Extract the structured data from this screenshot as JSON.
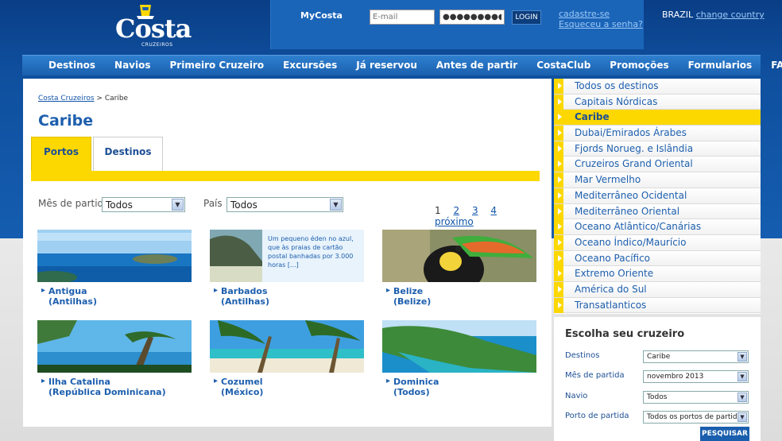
{
  "header": {
    "brand": "Costa",
    "brand_sub": "CRUZEIROS",
    "mycosta_label": "MyCosta",
    "email_placeholder": "E-mail",
    "password_value": "●●●●●●●●●",
    "login_label": "LOGIN",
    "register_link": "cadastre-se",
    "forgot_link": "Esqueceu a senha?",
    "country": "BRAZIL",
    "change_country": "change country"
  },
  "nav": {
    "items": [
      "Destinos",
      "Navios",
      "Primeiro Cruzeiro",
      "Excursões",
      "Já reservou",
      "Antes de partir",
      "CostaClub",
      "Promoções",
      "Formularios",
      "FAQ"
    ]
  },
  "main": {
    "breadcrumb_home": "Costa Cruzeiros",
    "breadcrumb_sep": ">",
    "breadcrumb_current": "Caribe",
    "title": "Caribe",
    "tabs": [
      "Portos",
      "Destinos"
    ],
    "filter_month_label": "Mês de partida",
    "filter_month_value": "Todos",
    "filter_country_label": "País",
    "filter_country_value": "Todos",
    "pager": {
      "current": "1",
      "pages": [
        "2",
        "3",
        "4"
      ],
      "next": "próximo"
    },
    "barbados_blurb": "Um pequeno éden no azul, que às praias de cartão postal banhadas por 3.000 horas [...]",
    "ports": [
      {
        "name": "Antigua",
        "region": "(Antilhas)"
      },
      {
        "name": "Barbados",
        "region": "(Antilhas)"
      },
      {
        "name": "Belize",
        "region": "(Belize)"
      },
      {
        "name": "Ilha Catalina",
        "region": "(República Dominicana)"
      },
      {
        "name": "Cozumel",
        "region": "(México)"
      },
      {
        "name": "Dominica",
        "region": "(Todos)"
      }
    ]
  },
  "sidebar": {
    "items": [
      "Todos os destinos",
      "Capitais Nórdicas",
      "Caribe",
      "Dubai/Emirados Árabes",
      "Fjords Norueg. e Islândia",
      "Cruzeiros Grand Oriental",
      "Mar Vermelho",
      "Mediterrâneo Ocidental",
      "Mediterrâneo Oriental",
      "Oceano Atlântico/Canárias",
      "Oceano Índico/Maurício",
      "Oceano Pacífico",
      "Extremo Oriente",
      "América do Sul",
      "Transatlanticos"
    ],
    "active_index": 2
  },
  "search": {
    "title": "Escolha seu cruzeiro",
    "fields": [
      {
        "label": "Destinos",
        "value": "Caribe"
      },
      {
        "label": "Mês de partida",
        "value": "novembro 2013"
      },
      {
        "label": "Navio",
        "value": "Todos"
      },
      {
        "label": "Porto de partida",
        "value": "Todos os portos de partid"
      }
    ],
    "button": "PESQUISAR"
  },
  "colors": {
    "brand_blue": "#1d5fae",
    "accent_yellow": "#fcd800",
    "nav_blue": "#2f80d0"
  }
}
